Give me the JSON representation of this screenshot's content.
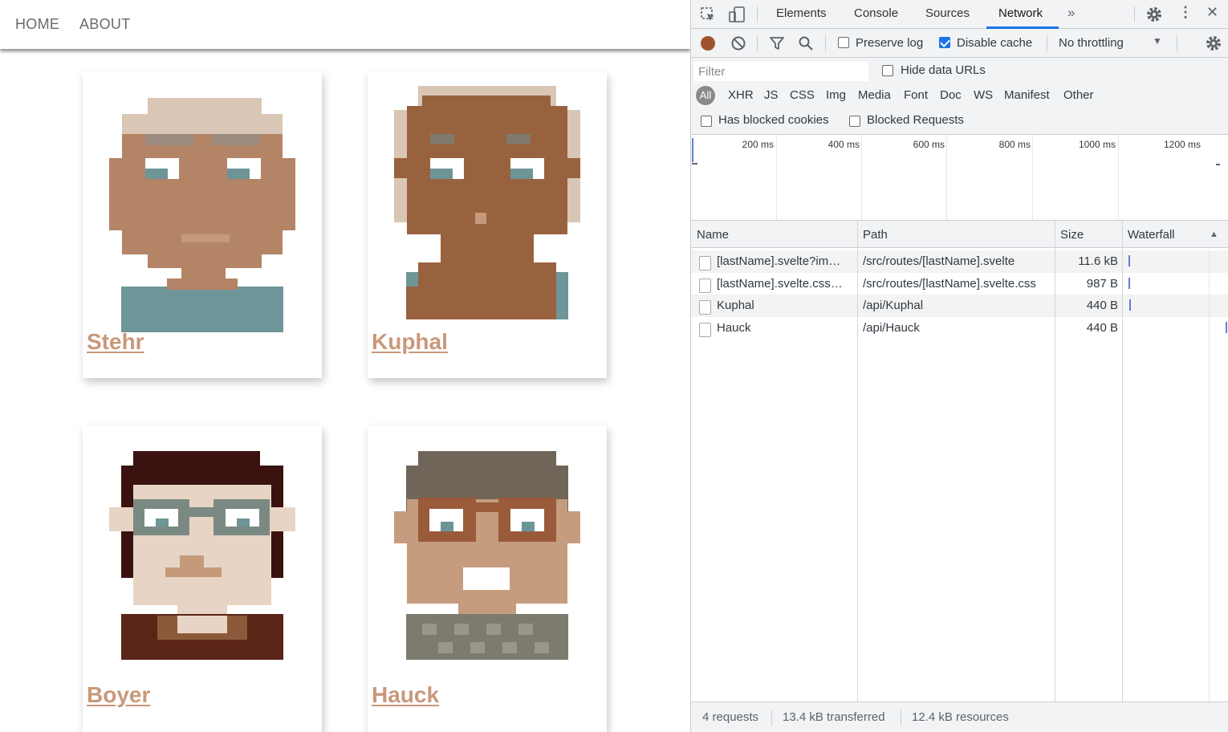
{
  "app": {
    "nav": [
      {
        "label": "HOME"
      },
      {
        "label": "ABOUT"
      }
    ],
    "cards": [
      {
        "name": "Stehr"
      },
      {
        "name": "Kuphal"
      },
      {
        "name": "Boyer"
      },
      {
        "name": "Hauck"
      }
    ]
  },
  "devtools": {
    "tabs": [
      "Elements",
      "Console",
      "Sources",
      "Network"
    ],
    "active_tab": "Network",
    "more_tabs_icon": "chevron-double-right-icon",
    "toolbar": {
      "preserve_log": {
        "label": "Preserve log",
        "checked": false
      },
      "disable_cache": {
        "label": "Disable cache",
        "checked": true
      },
      "throttling": "No throttling"
    },
    "filter": {
      "placeholder": "Filter"
    },
    "hide_data_urls": {
      "label": "Hide data URLs",
      "checked": false
    },
    "type_filters": [
      "All",
      "XHR",
      "JS",
      "CSS",
      "Img",
      "Media",
      "Font",
      "Doc",
      "WS",
      "Manifest",
      "Other"
    ],
    "has_blocked_cookies": {
      "label": "Has blocked cookies",
      "checked": false
    },
    "blocked_requests": {
      "label": "Blocked Requests",
      "checked": false
    },
    "timeline_ticks": [
      "200 ms",
      "400 ms",
      "600 ms",
      "800 ms",
      "1000 ms",
      "1200 ms"
    ],
    "columns": {
      "name": "Name",
      "path": "Path",
      "size": "Size",
      "waterfall": "Waterfall"
    },
    "requests": [
      {
        "name": "[lastName].svelte?im…",
        "path": "/src/routes/[lastName].svelte",
        "size": "11.6 kB"
      },
      {
        "name": "[lastName].svelte.css…",
        "path": "/src/routes/[lastName].svelte.css",
        "size": "987 B"
      },
      {
        "name": "Kuphal",
        "path": "/api/Kuphal",
        "size": "440 B"
      },
      {
        "name": "Hauck",
        "path": "/api/Hauck",
        "size": "440 B"
      }
    ],
    "status": {
      "requests": "4 requests",
      "transferred": "13.4 kB transferred",
      "resources": "12.4 kB resources"
    },
    "colors": {
      "accent": "#1a73e8",
      "record": "#a0522d",
      "link": "#c9987a"
    }
  }
}
